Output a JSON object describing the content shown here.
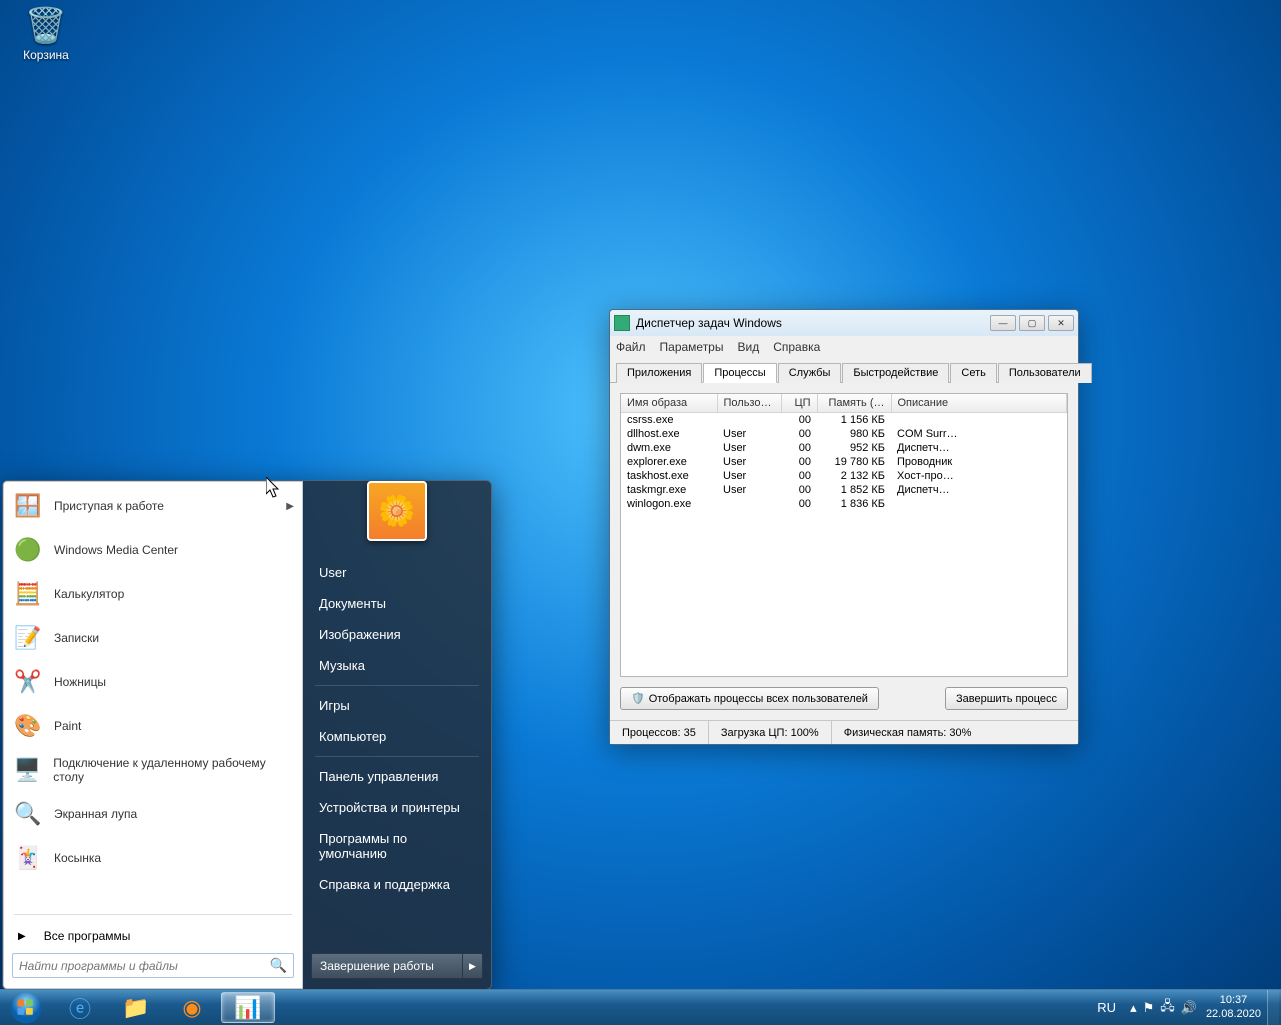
{
  "desktop": {
    "recycle_bin": "Корзина"
  },
  "start_menu": {
    "left_items": [
      {
        "label": "Приступая к работе",
        "icon": "🪟",
        "arrow": true
      },
      {
        "label": "Windows Media Center",
        "icon": "🟢"
      },
      {
        "label": "Калькулятор",
        "icon": "🧮"
      },
      {
        "label": "Записки",
        "icon": "📝"
      },
      {
        "label": "Ножницы",
        "icon": "✂️"
      },
      {
        "label": "Paint",
        "icon": "🎨"
      },
      {
        "label": "Подключение к удаленному рабочему столу",
        "icon": "🖥️"
      },
      {
        "label": "Экранная лупа",
        "icon": "🔍"
      },
      {
        "label": "Косынка",
        "icon": "🃏"
      }
    ],
    "all_programs": "Все программы",
    "search_placeholder": "Найти программы и файлы",
    "user_name": "User",
    "right_links_1": [
      "Документы",
      "Изображения",
      "Музыка"
    ],
    "right_links_2": [
      "Игры",
      "Компьютер"
    ],
    "right_links_3": [
      "Панель управления",
      "Устройства и принтеры",
      "Программы по умолчанию",
      "Справка и поддержка"
    ],
    "shutdown": "Завершение работы"
  },
  "task_manager": {
    "title": "Диспетчер задач Windows",
    "menu": [
      "Файл",
      "Параметры",
      "Вид",
      "Справка"
    ],
    "tabs": [
      "Приложения",
      "Процессы",
      "Службы",
      "Быстродействие",
      "Сеть",
      "Пользователи"
    ],
    "active_tab": 1,
    "columns": [
      "Имя образа",
      "Пользо…",
      "ЦП",
      "Память (…",
      "Описание"
    ],
    "rows": [
      {
        "name": "csrss.exe",
        "user": "",
        "cpu": "00",
        "mem": "1 156 КБ",
        "desc": ""
      },
      {
        "name": "dllhost.exe",
        "user": "User",
        "cpu": "00",
        "mem": "980 КБ",
        "desc": "COM Surr…"
      },
      {
        "name": "dwm.exe",
        "user": "User",
        "cpu": "00",
        "mem": "952 КБ",
        "desc": "Диспетч…"
      },
      {
        "name": "explorer.exe",
        "user": "User",
        "cpu": "00",
        "mem": "19 780 КБ",
        "desc": "Проводник"
      },
      {
        "name": "taskhost.exe",
        "user": "User",
        "cpu": "00",
        "mem": "2 132 КБ",
        "desc": "Хост-про…"
      },
      {
        "name": "taskmgr.exe",
        "user": "User",
        "cpu": "00",
        "mem": "1 852 КБ",
        "desc": "Диспетч…"
      },
      {
        "name": "winlogon.exe",
        "user": "",
        "cpu": "00",
        "mem": "1 836 КБ",
        "desc": ""
      }
    ],
    "show_all_users": "Отображать процессы всех пользователей",
    "end_process": "Завершить процесс",
    "status": {
      "processes": "Процессов: 35",
      "cpu": "Загрузка ЦП: 100%",
      "mem": "Физическая память: 30%"
    }
  },
  "taskbar": {
    "lang": "RU",
    "time": "10:37",
    "date": "22.08.2020"
  }
}
